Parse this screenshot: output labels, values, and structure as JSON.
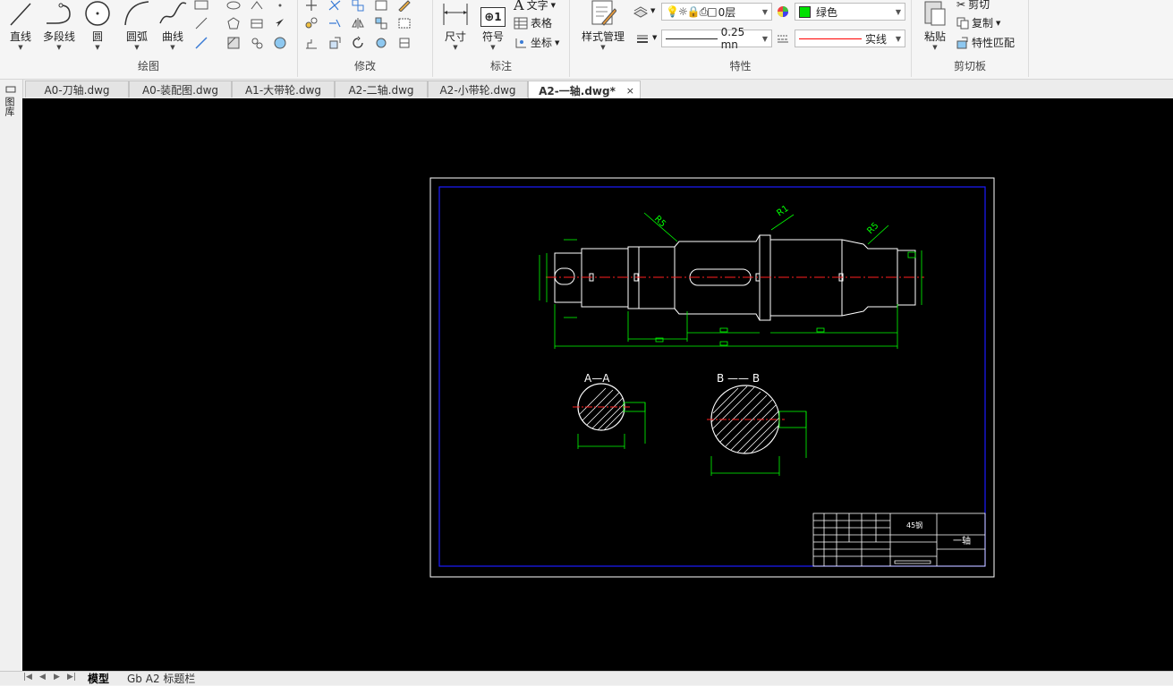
{
  "ribbon": {
    "draw": {
      "group_label": "绘图",
      "line_label": "直线",
      "polyline_label": "多段线",
      "circle_label": "圆",
      "arc_label": "圆弧",
      "curve_label": "曲线"
    },
    "modify": {
      "group_label": "修改"
    },
    "annotate": {
      "group_label": "标注",
      "dimension_label": "尺寸",
      "symbol_label": "符号",
      "symbol_value": "1",
      "text_label": "文字",
      "table_label": "表格",
      "coordinate_label": "坐标"
    },
    "properties": {
      "group_label": "特性",
      "style_manager_label": "样式管理",
      "layer_value": "0层",
      "color_value": "绿色",
      "color_swatch": "#00e000",
      "lineweight_value": "0.25 mn",
      "linetype_value": "实线",
      "linetype_color": "#ff0000"
    },
    "clipboard": {
      "group_label": "剪切板",
      "paste_label": "粘贴",
      "cut_label": "剪切",
      "copy_label": "复制",
      "match_label": "特性匹配"
    }
  },
  "tabs": [
    {
      "label": "A0-刀轴.dwg",
      "active": false
    },
    {
      "label": "A0-装配图.dwg",
      "active": false
    },
    {
      "label": "A1-大带轮.dwg",
      "active": false
    },
    {
      "label": "A2-二轴.dwg",
      "active": false
    },
    {
      "label": "A2-小带轮.dwg",
      "active": false
    },
    {
      "label": "A2-一轴.dwg*",
      "active": true
    }
  ],
  "tab_close": "×",
  "side_panel": {
    "label": "图库"
  },
  "drawing": {
    "radius_labels": [
      "R5",
      "R1",
      "R5"
    ],
    "section_a": "A—A",
    "section_b": "B —— B",
    "material": "45钢",
    "part_name": "一轴",
    "colors": {
      "border": "#1a1aff",
      "geometry": "#ffffff",
      "dimension": "#00ff00",
      "center": "#ff2020",
      "sheet": "#ffffff"
    }
  },
  "bottom": {
    "nav_icons": [
      "first-icon",
      "prev-icon",
      "next-icon",
      "last-icon"
    ],
    "model_tab": "模型",
    "layout_tab": "Gb A2 标题栏"
  }
}
